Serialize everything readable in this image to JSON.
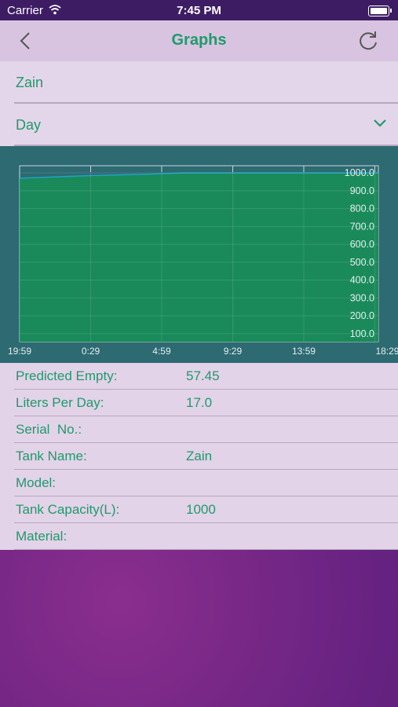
{
  "status_bar": {
    "carrier": "Carrier",
    "time": "7:45 PM"
  },
  "nav": {
    "title": "Graphs"
  },
  "selectors": {
    "tank": "Zain",
    "period": "Day"
  },
  "chart_data": {
    "type": "area",
    "x_tick_labels": [
      "19:59",
      "0:29",
      "4:59",
      "9:29",
      "13:59",
      "18:29"
    ],
    "y_tick_labels": [
      "1000.0",
      "900.0",
      "800.0",
      "700.0",
      "600.0",
      "500.0",
      "400.0",
      "300.0",
      "200.0",
      "100.0"
    ],
    "ylim": [
      55,
      1040
    ],
    "x": [
      0,
      1,
      2,
      2.3,
      3,
      4,
      5.05
    ],
    "values": [
      970,
      985,
      995,
      1000,
      1000,
      1000,
      1000
    ],
    "fill_color": "#1a8a5a",
    "line_color": "#1fa3c4",
    "grid": true,
    "y_axis_side": "right"
  },
  "info": [
    {
      "key": "Predicted Empty:",
      "value": "57.45"
    },
    {
      "key": "Liters Per Day:",
      "value": "17.0"
    },
    {
      "key": "Serial  No.:",
      "value": ""
    },
    {
      "key": "Tank Name:",
      "value": "Zain"
    },
    {
      "key": "Model:",
      "value": ""
    },
    {
      "key": "Tank Capacity(L):",
      "value": "1000"
    },
    {
      "key": "Material:",
      "value": ""
    }
  ],
  "colors": {
    "accent": "#1f9a6b",
    "status_bar": "#3e1c64",
    "nav_bg": "#d8c4e0",
    "chart_bg": "#2d6a72"
  },
  "icons": {
    "back": "chevron-left-icon",
    "refresh": "refresh-icon",
    "dropdown": "chevron-down-icon"
  }
}
